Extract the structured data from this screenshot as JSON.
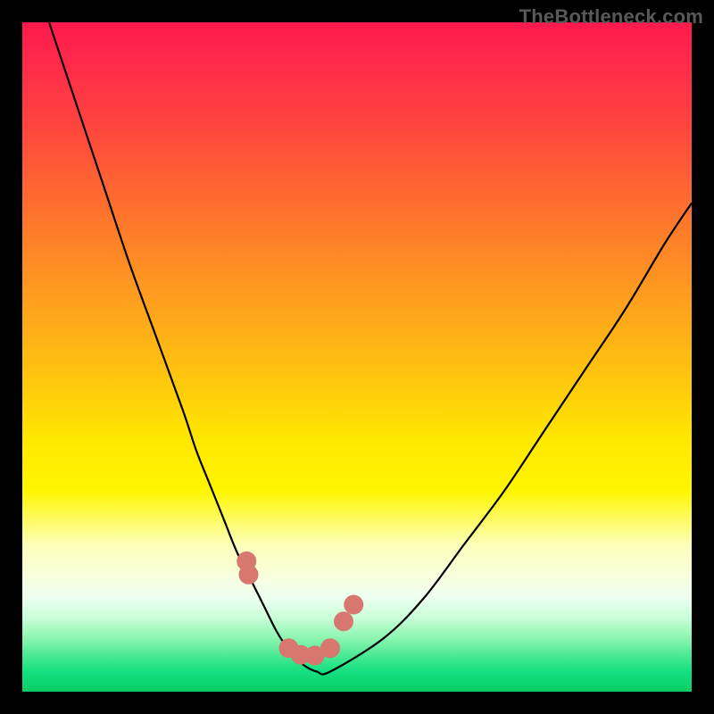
{
  "watermark": "TheBottleneck.com",
  "colors": {
    "background": "#000000",
    "watermark_text": "#595959",
    "curve_stroke": "#000000",
    "marker_fill": "#d7776f",
    "gradient_top": "#ff1a4d",
    "gradient_bottom": "#0ac85e"
  },
  "chart_data": {
    "type": "line",
    "title": "",
    "xlabel": "",
    "ylabel": "",
    "xlim": [
      0,
      100
    ],
    "ylim": [
      0,
      100
    ],
    "grid": false,
    "series": [
      {
        "name": "curve",
        "x": [
          4,
          8,
          12,
          16,
          20,
          24,
          26,
          28,
          30,
          32,
          34,
          36,
          38,
          40,
          42,
          44,
          46,
          54,
          60,
          66,
          72,
          78,
          84,
          90,
          96,
          100
        ],
        "y": [
          100,
          88,
          76,
          64,
          53,
          42,
          36,
          31,
          26,
          21,
          17,
          13,
          9,
          6,
          4,
          3,
          3,
          8,
          14,
          22,
          30,
          39,
          48,
          57,
          67,
          73
        ]
      }
    ],
    "markers": {
      "name": "highlight-points",
      "x_frac": [
        0.335,
        0.338,
        0.398,
        0.416,
        0.437,
        0.46,
        0.48,
        0.495
      ],
      "y_frac": [
        0.805,
        0.825,
        0.935,
        0.945,
        0.946,
        0.935,
        0.895,
        0.87
      ]
    }
  }
}
